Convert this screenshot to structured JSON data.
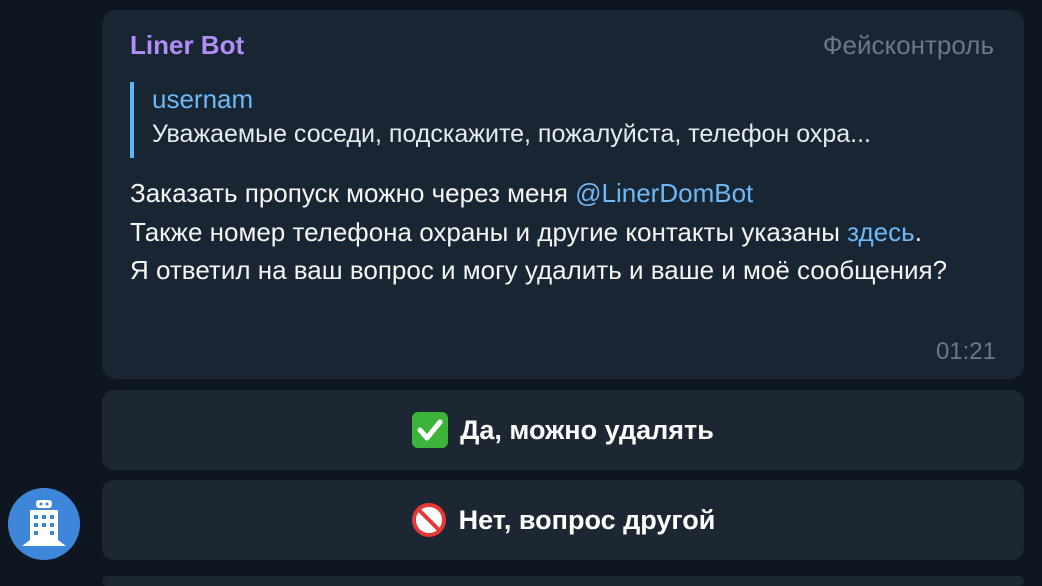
{
  "message": {
    "sender": "Liner Bot",
    "admin_title": "Фейсконтроль",
    "reply": {
      "author": "usernam",
      "text": "Уважаемые соседи, подскажите, пожалуйста, телефон охра..."
    },
    "line1_prefix": "Заказать пропуск можно через меня ",
    "line1_mention": "@LinerDomBot",
    "line2": "Также номер телефона охраны и другие контакты указаны ",
    "line2_link": "здесь",
    "line2_suffix": ".",
    "line3": "Я ответил на ваш вопрос и могу удалить и ваше и моё сообщения?",
    "time": "01:21"
  },
  "keyboard": {
    "yes_label": "Да, можно удалять",
    "no_label": "Нет, вопрос другой"
  },
  "icons": {
    "yes": "check-mark-icon",
    "no": "prohibited-icon",
    "avatar": "bot-avatar-icon"
  },
  "colors": {
    "background": "#0e1621",
    "bubble": "#182533",
    "button": "#1d2733",
    "sender": "#b18ef5",
    "link": "#6fb8f5",
    "reply_bar": "#5eb5f7",
    "meta": "#6c7883"
  }
}
